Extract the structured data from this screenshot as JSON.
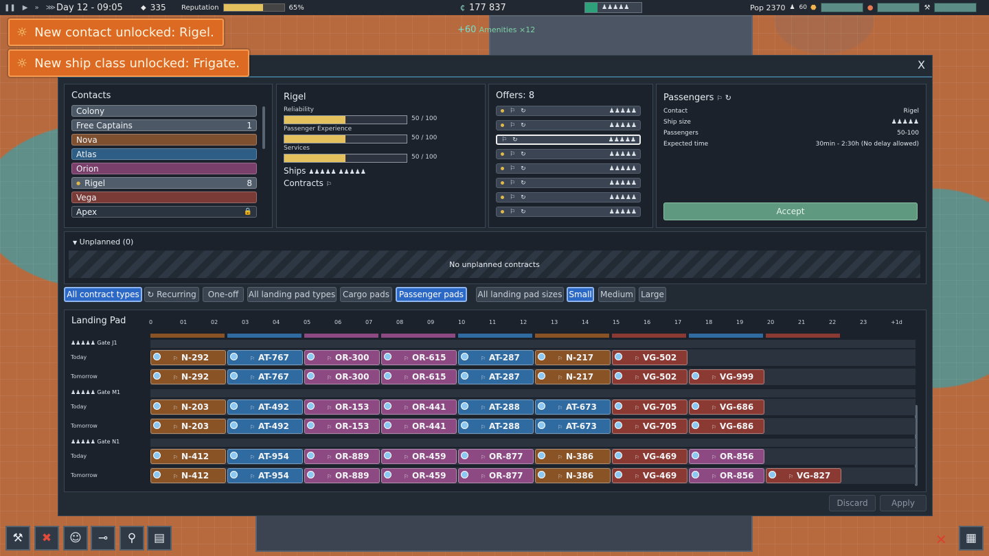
{
  "topbar": {
    "time": "Day 12 - 09:05",
    "resource": "335",
    "reputation_label": "Reputation",
    "reputation_pct": "65%",
    "reputation_value": 0.65,
    "credits": "177 837",
    "pop_label": "Pop 2370",
    "pop_sub": "60"
  },
  "world": {
    "amenities_gain": "+60",
    "amenities_label": "Amenities ×12"
  },
  "toasts": [
    {
      "text": "New contact unlocked: Rigel."
    },
    {
      "text": "New ship class unlocked: Frigate."
    }
  ],
  "dialog": {
    "close_label": "X"
  },
  "contacts": {
    "title": "Contacts",
    "items": [
      {
        "name": "Colony",
        "badge": "",
        "color": "#4c5865"
      },
      {
        "name": "Free Captains",
        "badge": "1",
        "color": "#4c5865"
      },
      {
        "name": "Nova",
        "badge": "",
        "color": "#7e5030"
      },
      {
        "name": "Atlas",
        "badge": "",
        "color": "#2e5d86"
      },
      {
        "name": "Orion",
        "badge": "",
        "color": "#7a3f6b"
      },
      {
        "name": "Rigel",
        "badge": "8",
        "color": "#525d6b"
      },
      {
        "name": "Vega",
        "badge": "",
        "color": "#7a3a36"
      },
      {
        "name": "Apex",
        "badge": "",
        "color": "#2a3340"
      }
    ]
  },
  "rigel": {
    "title": "Rigel",
    "stats": [
      {
        "label": "Reliability",
        "value": "50 / 100",
        "fraction": 0.5
      },
      {
        "label": "Passenger Experience",
        "value": "50 / 100",
        "fraction": 0.5
      },
      {
        "label": "Services",
        "value": "50 / 100",
        "fraction": 0.5
      }
    ],
    "ships_label": "Ships",
    "contracts_label": "Contracts"
  },
  "offers": {
    "title": "Offers: 8",
    "count": 8,
    "selected_index": 2
  },
  "passengers": {
    "title": "Passengers",
    "rows": [
      {
        "key": "Contact",
        "value": "Rigel"
      },
      {
        "key": "Ship size",
        "value": ""
      },
      {
        "key": "Passengers",
        "value": "50-100"
      },
      {
        "key": "Expected time",
        "value": "30min - 2:30h (No delay allowed)"
      }
    ],
    "accept_label": "Accept"
  },
  "unplanned": {
    "title": "Unplanned (0)",
    "empty_text": "No unplanned contracts"
  },
  "filters": [
    {
      "label": "All contract types",
      "on": true
    },
    {
      "label": "↻ Recurring",
      "on": false
    },
    {
      "label": "One-off",
      "on": false
    },
    {
      "label": "All landing pad types",
      "on": false
    },
    {
      "label": "Cargo pads",
      "on": false
    },
    {
      "label": "Passenger pads",
      "on": true
    },
    {
      "label": "All landing pad sizes",
      "on": false
    },
    {
      "label": "Small",
      "on": true
    },
    {
      "label": "Medium",
      "on": false
    },
    {
      "label": "Large",
      "on": false
    }
  ],
  "schedule": {
    "title": "Landing Pad",
    "hours": [
      "0",
      "01",
      "02",
      "03",
      "04",
      "05",
      "06",
      "07",
      "08",
      "09",
      "10",
      "11",
      "12",
      "13",
      "14",
      "15",
      "16",
      "17",
      "18",
      "19",
      "20",
      "21",
      "22",
      "23",
      "+1d"
    ],
    "gates": [
      {
        "name": "Gate J1",
        "rows": [
          {
            "day": "Today",
            "slots": [
              "N-292",
              "AT-767",
              "OR-300",
              "OR-615",
              "AT-287",
              "N-217",
              "VG-502"
            ]
          },
          {
            "day": "Tomorrow",
            "slots": [
              "N-292",
              "AT-767",
              "OR-300",
              "OR-615",
              "AT-287",
              "N-217",
              "VG-502",
              "VG-999"
            ]
          }
        ]
      },
      {
        "name": "Gate M1",
        "rows": [
          {
            "day": "Today",
            "slots": [
              "N-203",
              "AT-492",
              "OR-153",
              "OR-441",
              "AT-288",
              "AT-673",
              "VG-705",
              "VG-686"
            ]
          },
          {
            "day": "Tomorrow",
            "slots": [
              "N-203",
              "AT-492",
              "OR-153",
              "OR-441",
              "AT-288",
              "AT-673",
              "VG-705",
              "VG-686"
            ]
          }
        ]
      },
      {
        "name": "Gate N1",
        "rows": [
          {
            "day": "Today",
            "slots": [
              "N-412",
              "AT-954",
              "OR-889",
              "OR-459",
              "OR-877",
              "N-386",
              "VG-469",
              "OR-856"
            ]
          },
          {
            "day": "Tomorrow",
            "slots": [
              "N-412",
              "AT-954",
              "OR-889",
              "OR-459",
              "OR-877",
              "N-386",
              "VG-469",
              "OR-856",
              "VG-827"
            ]
          }
        ]
      }
    ],
    "colors": {
      "N": "#8a5326",
      "AT": "#2f6aa0",
      "OR": "#8d4a82",
      "VG": "#8b3a33"
    }
  },
  "footer": {
    "discard_label": "Discard",
    "apply_label": "Apply"
  }
}
